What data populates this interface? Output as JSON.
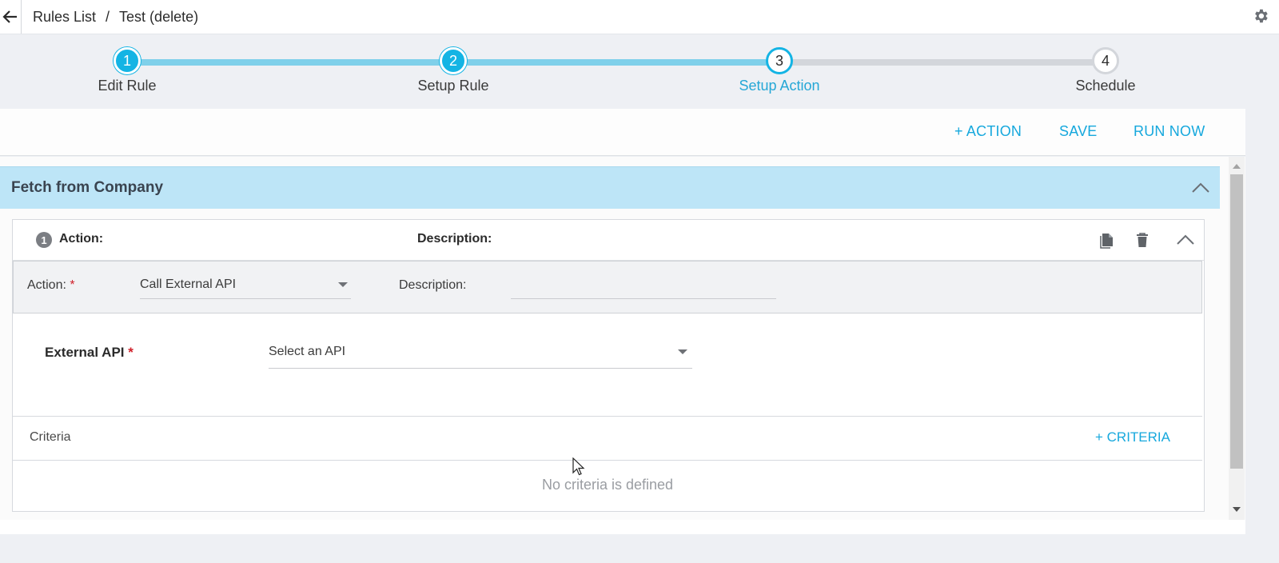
{
  "header": {
    "breadcrumb": [
      "Rules List",
      "Test (delete)"
    ],
    "separator": "/"
  },
  "stepper": {
    "steps": [
      {
        "number": "1",
        "label": "Edit Rule",
        "state": "done"
      },
      {
        "number": "2",
        "label": "Setup Rule",
        "state": "done"
      },
      {
        "number": "3",
        "label": "Setup Action",
        "state": "active"
      },
      {
        "number": "4",
        "label": "Schedule",
        "state": "todo"
      }
    ]
  },
  "toolbar": {
    "add_action_label": "+ ACTION",
    "save_label": "SAVE",
    "run_now_label": "RUN NOW"
  },
  "section": {
    "title": "Fetch from Company"
  },
  "action_card": {
    "number": "1",
    "action_heading": "Action:",
    "description_heading": "Description:",
    "action_label": "Action:",
    "action_value": "Call External API",
    "description_label": "Description:",
    "description_value": "",
    "external_api_label": "External API",
    "external_api_placeholder": "Select an API",
    "required_mark": "*",
    "criteria_title": "Criteria",
    "criteria_add_label": "+ CRITERIA",
    "criteria_empty": "No criteria is defined"
  },
  "colors": {
    "accent": "#16a8dd",
    "section_header": "#bde5f7",
    "required": "#d0202a"
  }
}
